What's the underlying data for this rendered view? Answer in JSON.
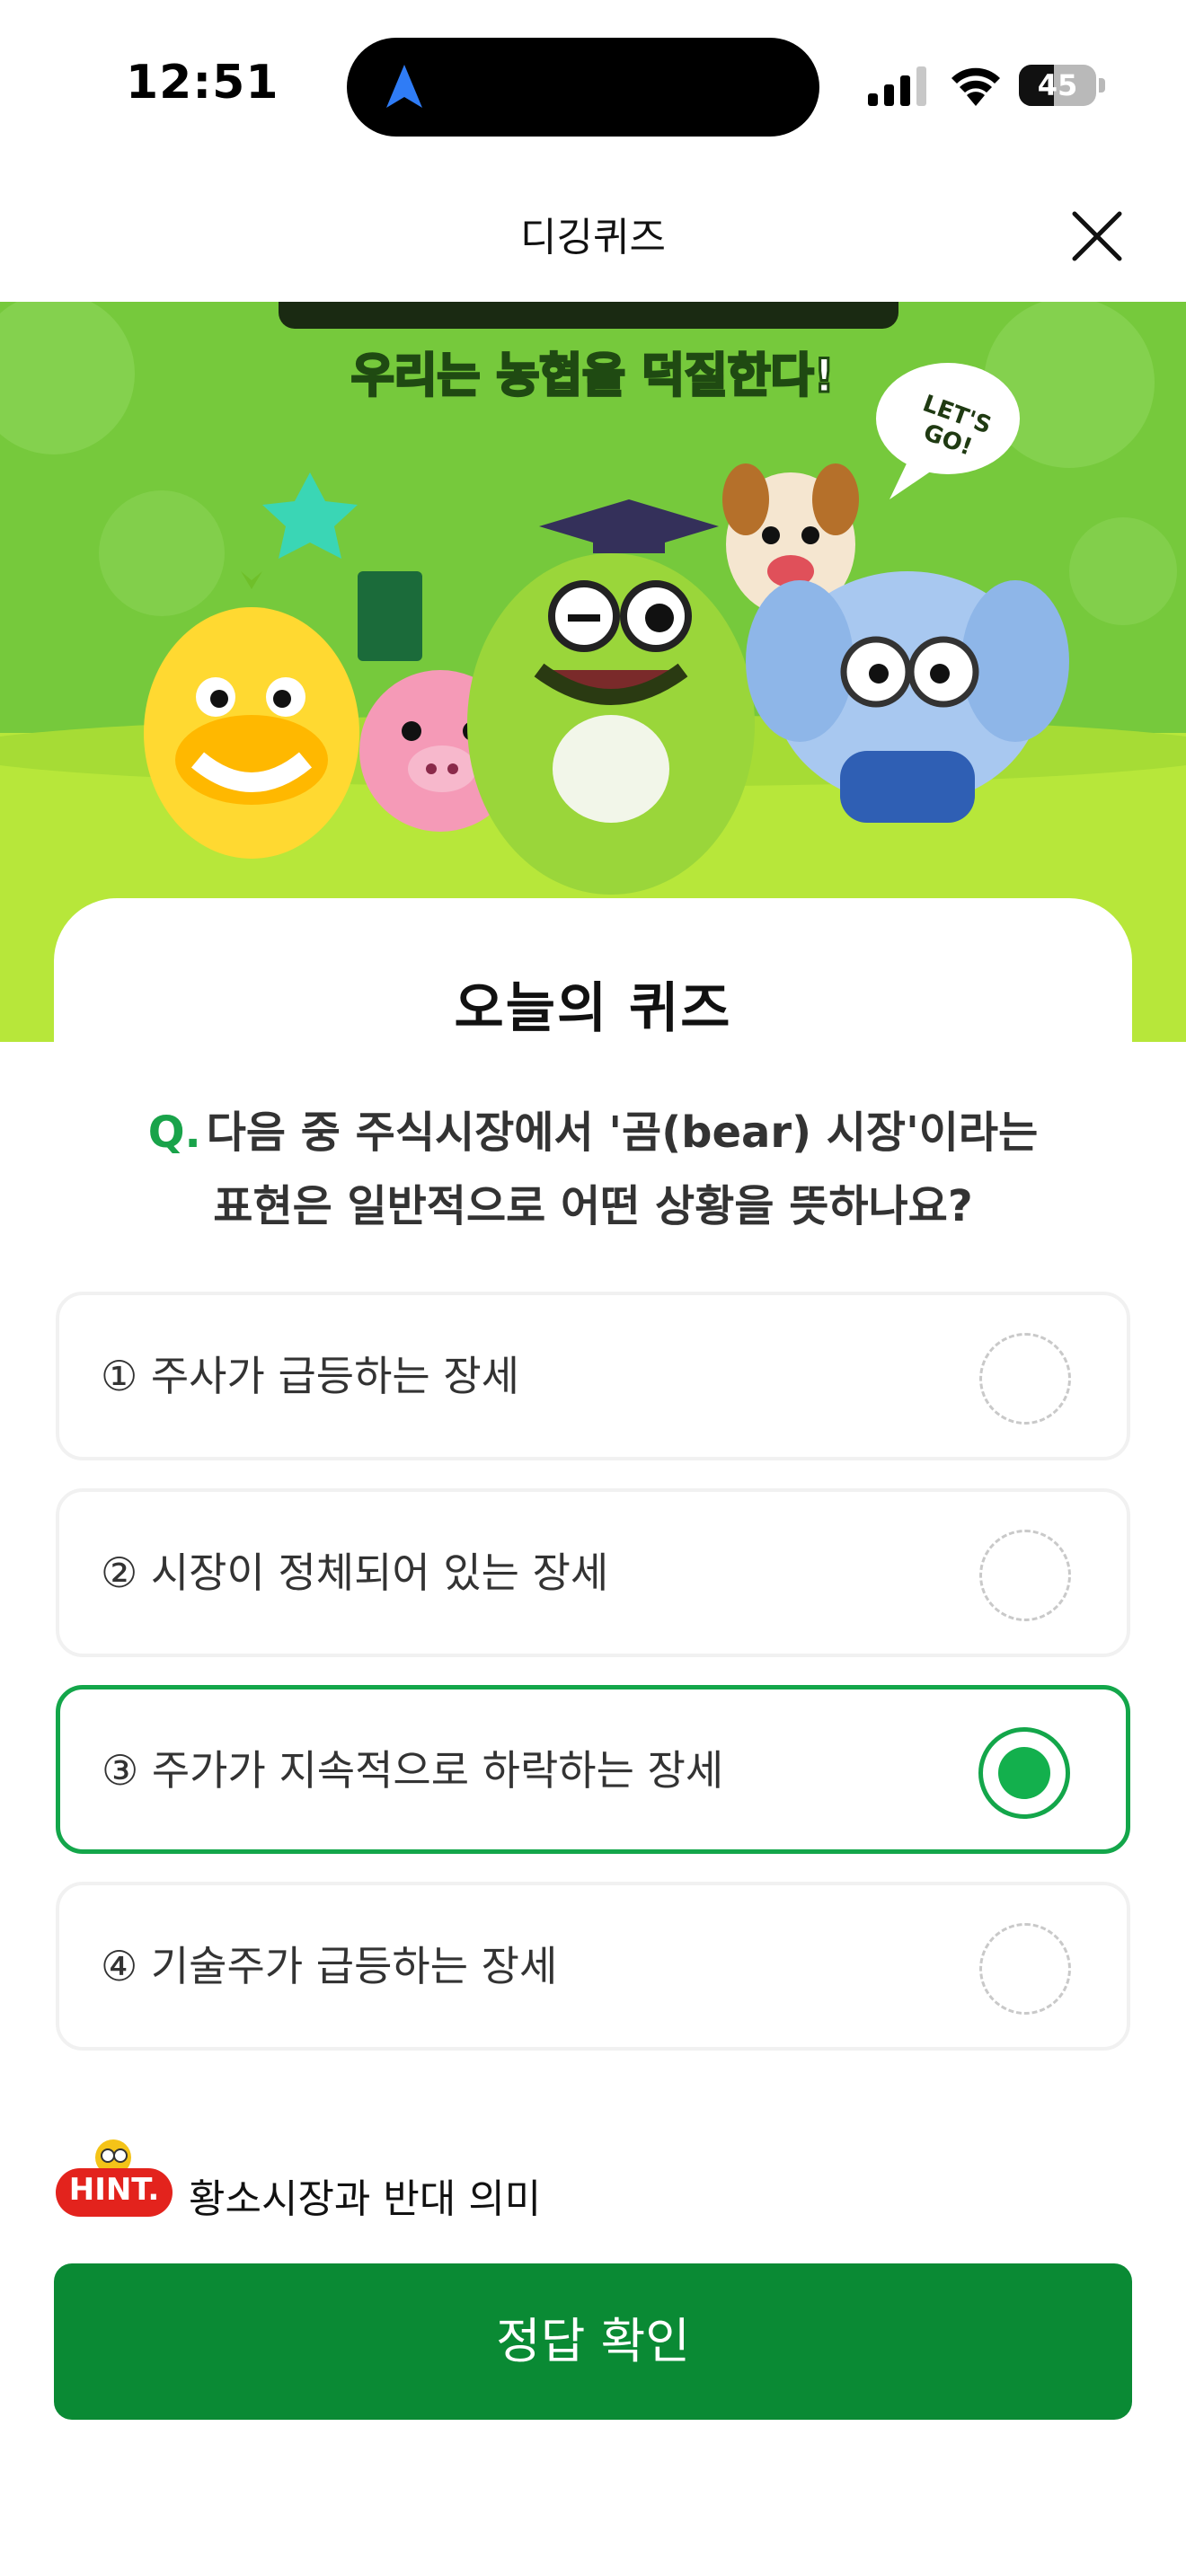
{
  "status_bar": {
    "time": "12:51",
    "battery": "45",
    "battery_level": 0.45,
    "icons": [
      "location-arrow-icon",
      "cellular-signal-icon",
      "wifi-icon",
      "battery-icon"
    ]
  },
  "header": {
    "title": "디깅퀴즈",
    "close_icon": "close-icon"
  },
  "banner": {
    "slogan": "우리는 농협을 덕질한다!",
    "bubble": "LET'S GO!"
  },
  "quiz": {
    "title": "오늘의 퀴즈",
    "q_mark": "Q.",
    "question_line1": "다음 중 주식시장에서 '곰(bear) 시장'이라는",
    "question_line2": "표현은 일반적으로 어떤 상황을 뜻하나요?",
    "options": [
      {
        "label": "① 주사가 급등하는 장세",
        "selected": false
      },
      {
        "label": "② 시장이 정체되어 있는 장세",
        "selected": false
      },
      {
        "label": "③ 주가가 지속적으로 하락하는 장세",
        "selected": true
      },
      {
        "label": "④ 기술주가 급등하는 장세",
        "selected": false
      }
    ],
    "hint_badge": "HINT.",
    "hint_text": "황소시장과 반대 의미",
    "submit_label": "정답 확인"
  },
  "colors": {
    "accent": "#13a64a",
    "submit_bg": "#0a8a34",
    "banner_green": "#7ccf3a",
    "hint_red": "#e3231d"
  }
}
